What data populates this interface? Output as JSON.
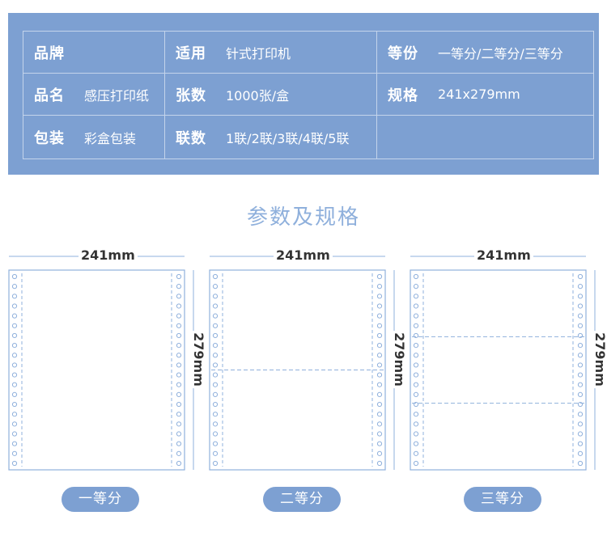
{
  "spec_table": {
    "rows": [
      [
        {
          "key": "品牌",
          "value": ""
        },
        {
          "key": "适用",
          "value": "针式打印机"
        },
        {
          "key": "等份",
          "value": "一等分/二等分/三等分"
        }
      ],
      [
        {
          "key": "品名",
          "value": "感压打印纸"
        },
        {
          "key": "张数",
          "value": "1000张/盒"
        },
        {
          "key": "规格",
          "value": "241x279mm"
        }
      ],
      [
        {
          "key": "包装",
          "value": "彩盒包装"
        },
        {
          "key": "联数",
          "value": "1联/2联/3联/4联/5联"
        },
        {
          "key": "",
          "value": ""
        }
      ]
    ]
  },
  "section_title": "参数及规格",
  "diagrams": [
    {
      "width_label": "241mm",
      "height_label": "279mm",
      "divisions": 1,
      "caption": "一等分"
    },
    {
      "width_label": "241mm",
      "height_label": "279mm",
      "divisions": 2,
      "caption": "二等分"
    },
    {
      "width_label": "241mm",
      "height_label": "279mm",
      "divisions": 3,
      "caption": "三等分"
    }
  ],
  "colors": {
    "panel": "#7da0d2",
    "line": "#8fb0dc",
    "title": "#8fb0dc"
  }
}
